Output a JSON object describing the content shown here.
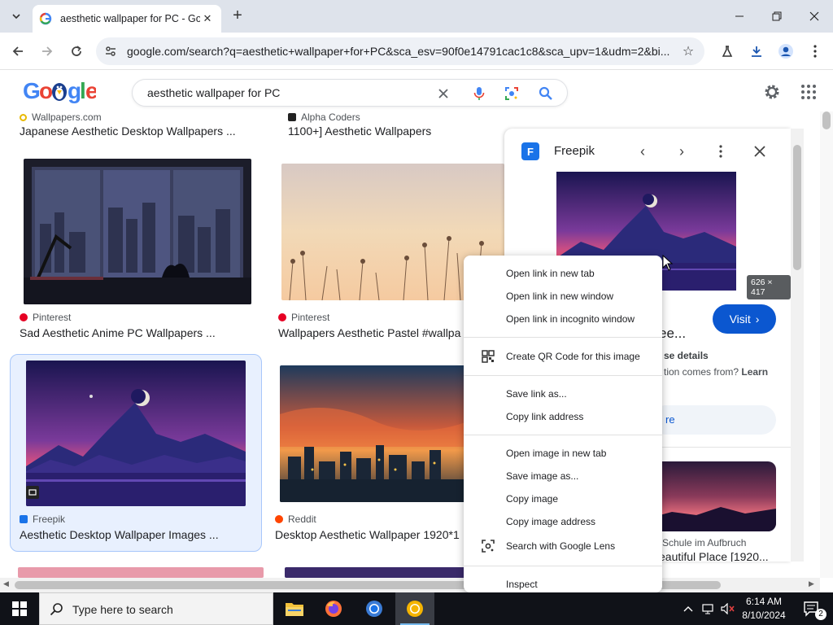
{
  "browser": {
    "tab_title": "aesthetic wallpaper for PC - Google Search",
    "url": "google.com/search?q=aesthetic+wallpaper+for+PC&sca_esv=90f0e14791cac1c8&sca_upv=1&udm=2&bi..."
  },
  "google": {
    "query": "aesthetic wallpaper for PC"
  },
  "results": [
    {
      "source": "Wallpapers.com",
      "title": "Japanese Aesthetic Desktop Wallpapers ..."
    },
    {
      "source": "Alpha Coders",
      "title": "1100+] Aesthetic Wallpapers"
    },
    {
      "source": "Pinterest",
      "title": "Sad Aesthetic Anime PC Wallpapers ..."
    },
    {
      "source": "Pinterest",
      "title": "Wallpapers Aesthetic Pastel #wallpa"
    },
    {
      "source": "Freepik",
      "title": "Aesthetic Desktop Wallpaper Images ..."
    },
    {
      "source": "Reddit",
      "title": "Desktop Aesthetic Wallpaper 1920*1"
    }
  ],
  "panel": {
    "site": "Freepik",
    "dims": "626 × 417",
    "visit_label": "Visit",
    "heading": "ee...",
    "line1": "se details",
    "line2_a": "tion comes from? ",
    "line2_b": "Learn",
    "pill": "re",
    "related_source": "Schule im Aufbruch",
    "related_title": "eautiful Place [1920..."
  },
  "context_menu": {
    "items": [
      "Open link in new tab",
      "Open link in new window",
      "Open link in incognito window",
      "Create QR Code for this image",
      "Save link as...",
      "Copy link address",
      "Open image in new tab",
      "Save image as...",
      "Copy image",
      "Copy image address",
      "Search with Google Lens",
      "Inspect"
    ]
  },
  "taskbar": {
    "search_placeholder": "Type here to search",
    "time": "6:14 AM",
    "date": "8/10/2024",
    "notif_count": "2"
  }
}
